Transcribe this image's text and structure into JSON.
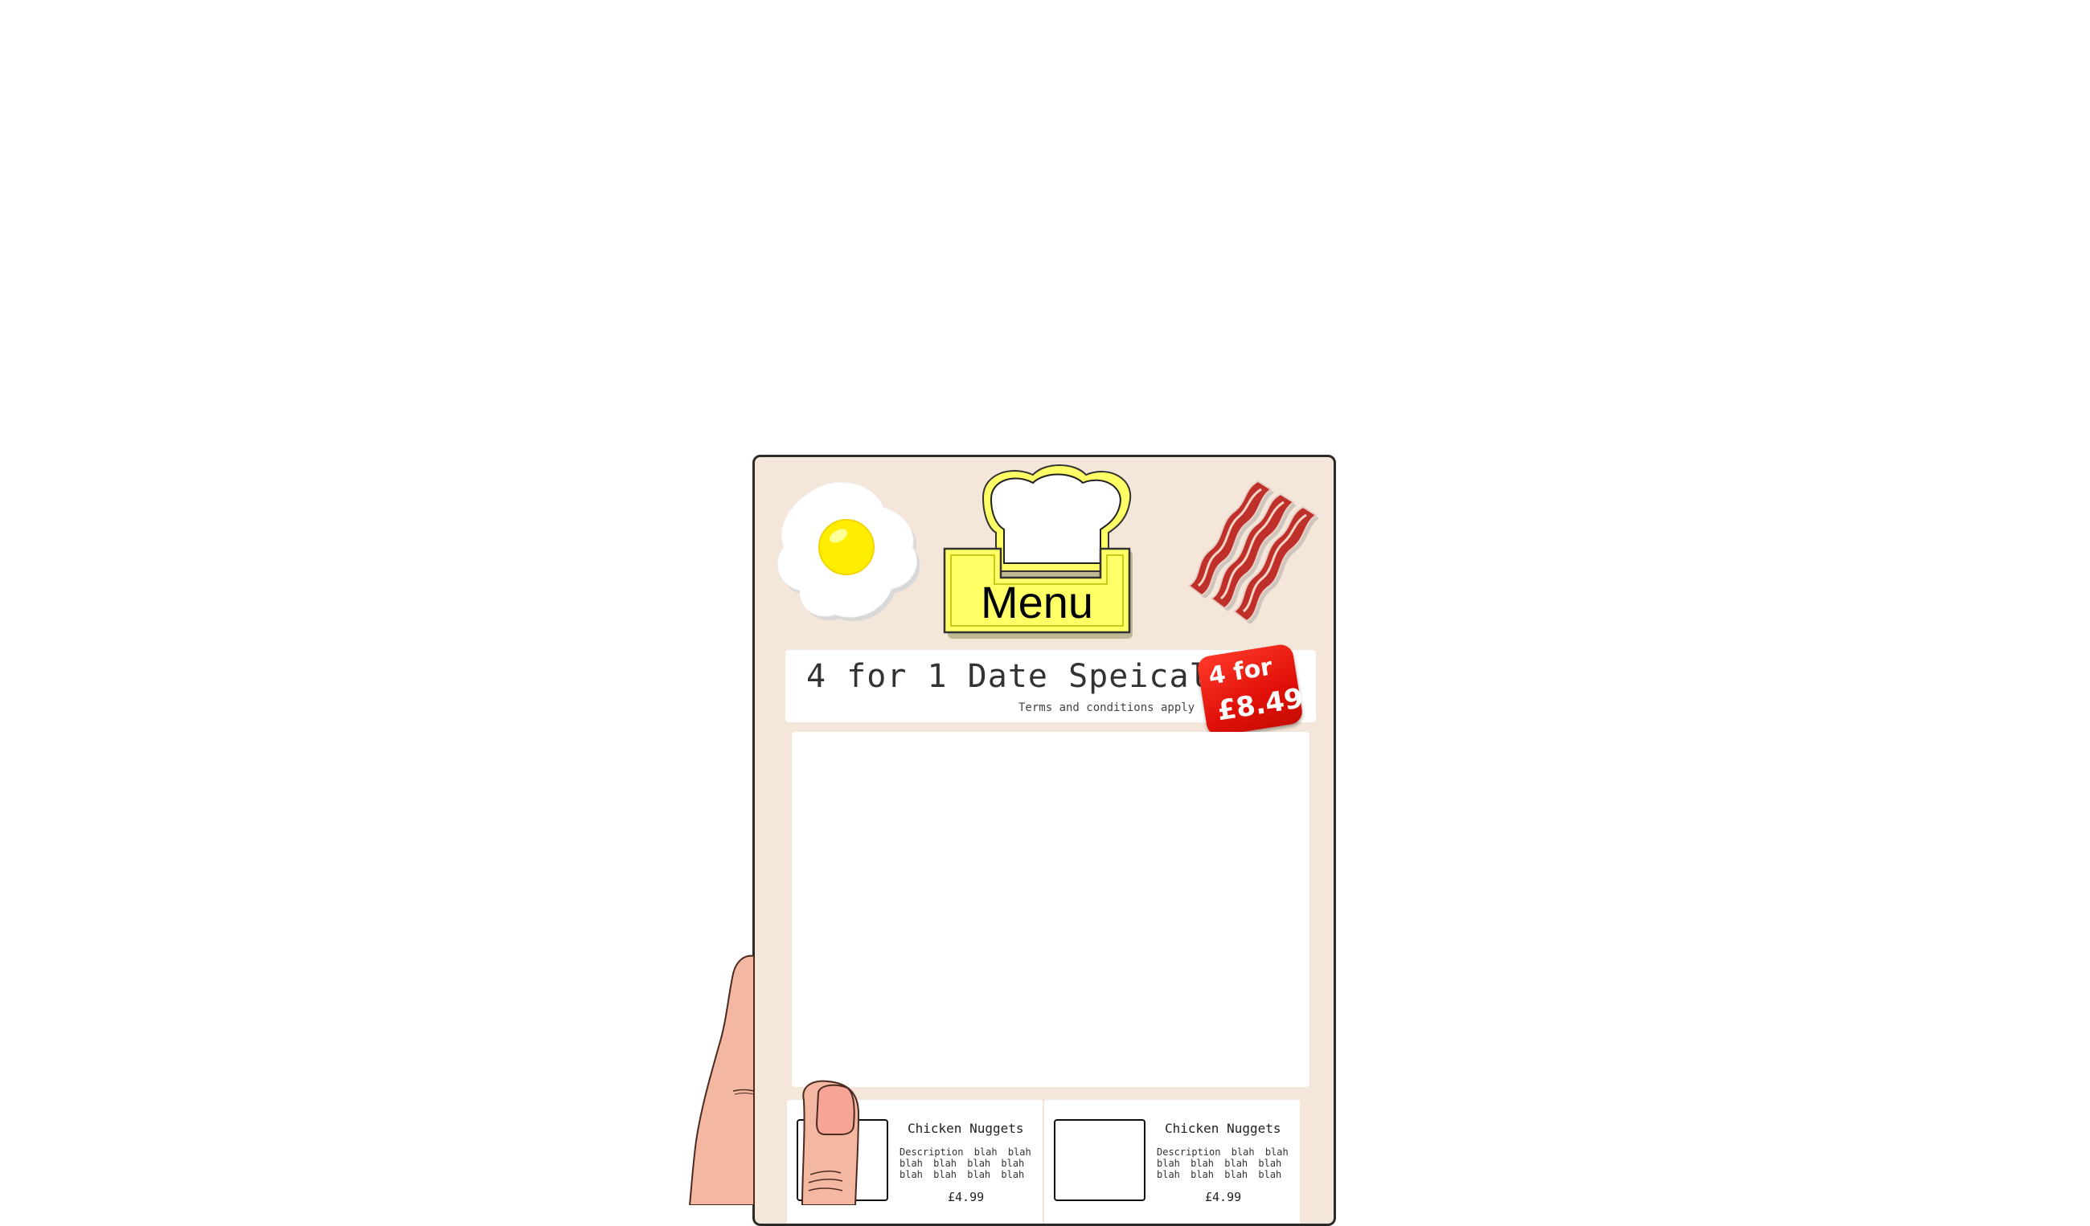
{
  "menu_board": {
    "menu_label": "Menu",
    "special": {
      "title": "4 for 1 Date Speical",
      "terms": "Terms and conditions apply",
      "badge_line1": "4 for",
      "badge_line2": "£8.49"
    },
    "items": [
      {
        "title": "Chicken Nuggets",
        "description": "Description blah blah blah blah blah blah blah blah blah blah",
        "price": "£4.99"
      },
      {
        "title": "Chicken Nuggets",
        "description": "Description blah blah blah blah blah blah blah blah blah blah",
        "price": "£4.99"
      }
    ]
  },
  "icons": [
    "fried-egg-icon",
    "chef-hat-icon",
    "bacon-icon"
  ],
  "colors": {
    "board_background": "#f4e7d9",
    "menu_sign": "#ffff66",
    "badge_red": "#e01008",
    "egg_yolk": "#ffee00",
    "bacon": "#c0302a",
    "skin": "#f4b8a2"
  }
}
